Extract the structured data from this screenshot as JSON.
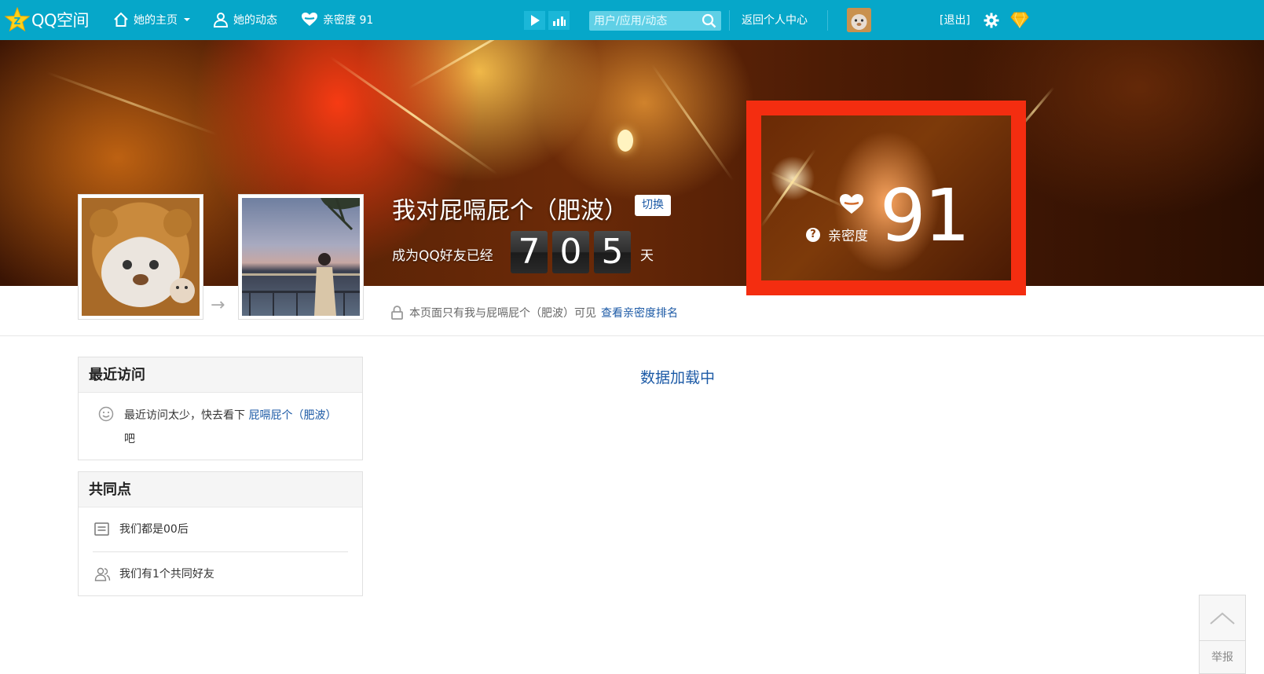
{
  "nav": {
    "logo_text": "QQ空间",
    "home_label": "她的主页",
    "feed_label": "她的动态",
    "intimacy_label": "亲密度 91",
    "search_placeholder": "用户/应用/动态",
    "return_label": "返回个人中心",
    "logout_label": "[退出]"
  },
  "profile": {
    "friend_name": "我对屁嗝屁个（肥波）",
    "switch_label": "切换",
    "friend_since_label": "成为QQ好友已经",
    "friend_days_digits": [
      "7",
      "0",
      "5"
    ],
    "day_unit": "天",
    "intimacy_label": "亲密度",
    "intimacy_value": "91",
    "help_mark": "?",
    "privacy_text": "本页面只有我与屁嗝屁个（肥波）可见",
    "ranking_link": "查看亲密度排名"
  },
  "recent_visits": {
    "title": "最近访问",
    "text_before": "最近访问太少，快去看下",
    "link_text": "屁嗝屁个（肥波）",
    "text_after": "吧"
  },
  "common": {
    "title": "共同点",
    "items": [
      "我们都是00后",
      "我们有1个共同好友"
    ]
  },
  "main": {
    "loading_text": "数据加载中"
  },
  "side_tools": {
    "report_label": "举报"
  },
  "colors": {
    "nav_bg": "#06a7c9",
    "highlight_border": "#f42d10",
    "link": "#1c5aa6"
  }
}
